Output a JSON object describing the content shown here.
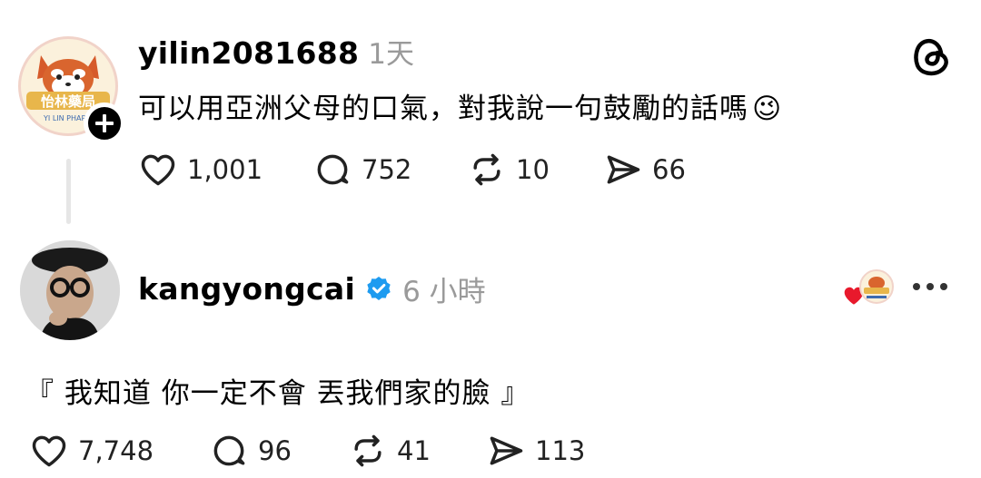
{
  "original_post": {
    "username": "yilin2081688",
    "time": "1天",
    "avatar_text": "怡林藥局",
    "avatar_subtext": "YI LIN PHARM",
    "text": "可以用亞洲父母的口氣，對我說一句鼓勵的話嗎",
    "emoji": "😉",
    "likes": "1,001",
    "replies": "752",
    "reposts": "10",
    "shares": "66"
  },
  "reply_post": {
    "username": "kangyongcai",
    "time": "6 小時",
    "verified": true,
    "text": "『 我知道 你一定不會 丟我們家的臉 』",
    "likes": "7,748",
    "replies": "96",
    "reposts": "41",
    "shares": "113"
  },
  "colors": {
    "heart_red": "#e8192c",
    "verified_blue": "#1d9bf0",
    "muted": "#9a9a9a"
  },
  "icons": [
    "threads-logo-icon",
    "heart-icon",
    "comment-icon",
    "repost-icon",
    "share-icon",
    "verified-badge-icon",
    "more-icon",
    "follow-plus-icon"
  ]
}
